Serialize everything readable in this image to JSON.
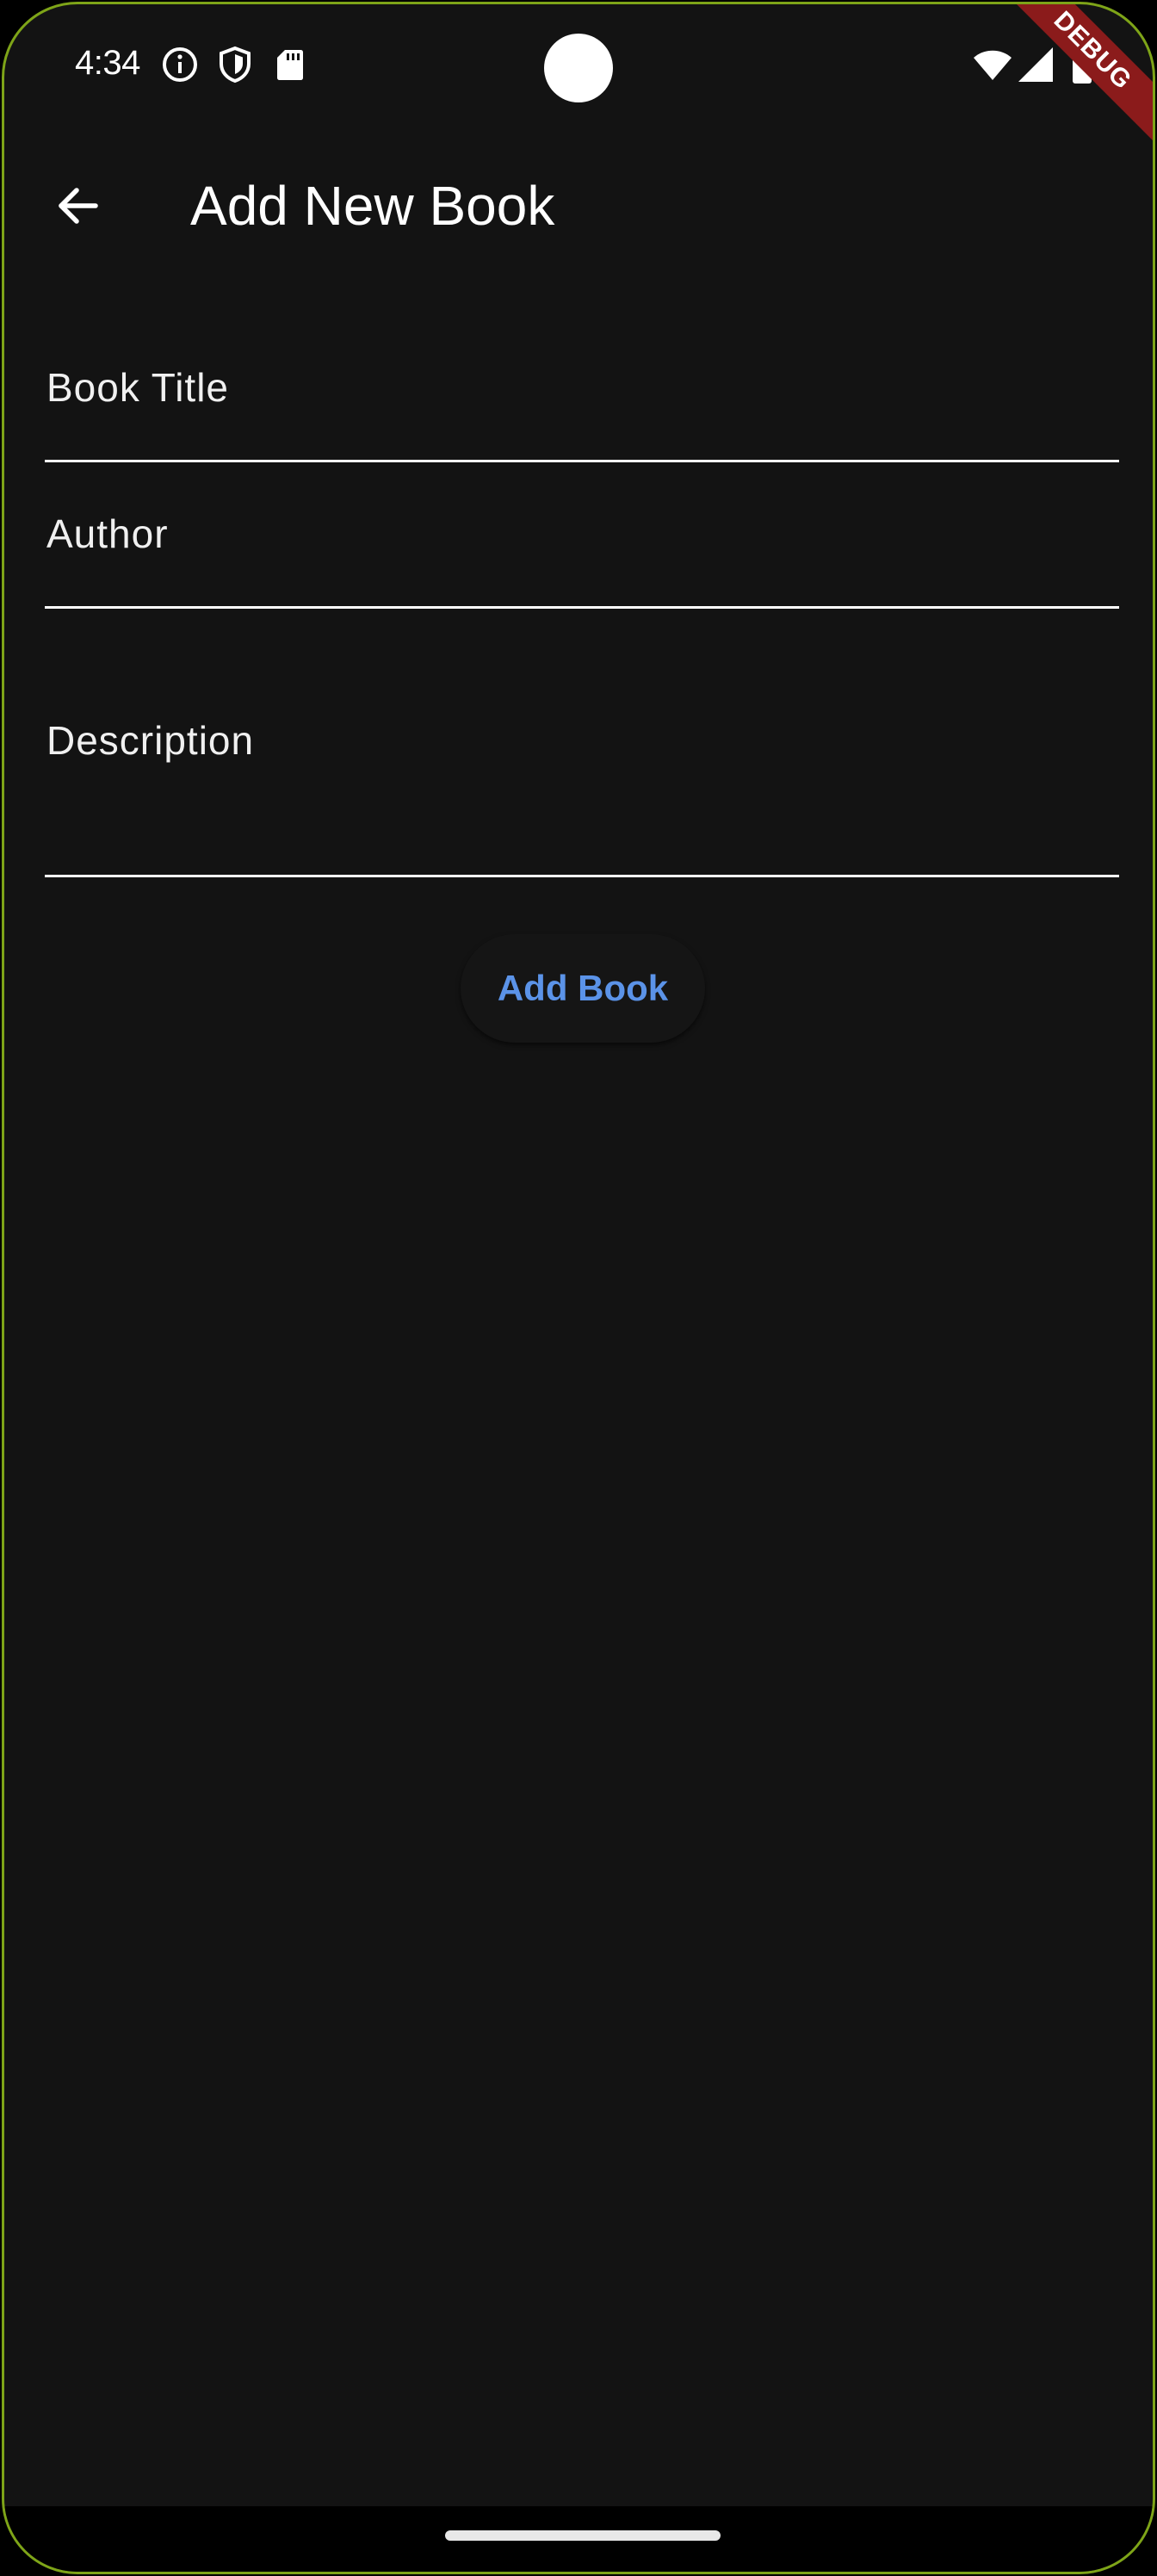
{
  "status_bar": {
    "time": "4:34",
    "left_icons": [
      "info-icon",
      "shield-icon",
      "sd-card-icon"
    ],
    "right_icons": [
      "wifi-icon",
      "signal-icon",
      "battery-icon"
    ]
  },
  "debug_banner": {
    "label": "DEBUG",
    "color": "#8b1b1b"
  },
  "app_bar": {
    "back_icon": "arrow-back-icon",
    "title": "Add New Book"
  },
  "form": {
    "book_title": {
      "label": "Book Title",
      "value": ""
    },
    "author": {
      "label": "Author",
      "value": ""
    },
    "description": {
      "label": "Description",
      "value": ""
    },
    "submit_label": "Add Book"
  },
  "colors": {
    "background": "#131313",
    "accent": "#5b93e8",
    "text": "#ffffff",
    "frame": "#7ea418"
  }
}
